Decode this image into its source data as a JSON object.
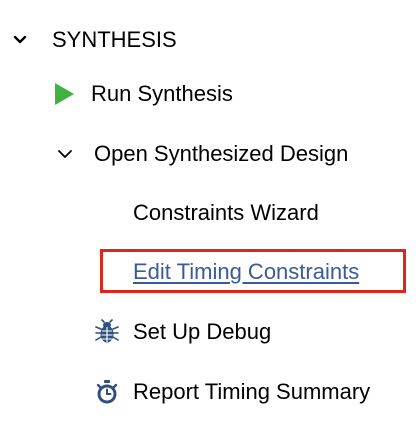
{
  "section": {
    "title": "SYNTHESIS",
    "expanded_icon": "chevron-down-icon"
  },
  "items": {
    "run_synthesis": {
      "label": "Run Synthesis",
      "icon": "play-icon",
      "icon_color": "#3fb23f"
    },
    "open_synthesized": {
      "label": "Open Synthesized Design",
      "icon": "chevron-down-icon"
    },
    "constraints_wizard": {
      "label": "Constraints Wizard"
    },
    "edit_timing": {
      "label": "Edit Timing Constraints",
      "link_color": "#3a5a9c"
    },
    "setup_debug": {
      "label": "Set Up Debug",
      "icon": "bug-icon",
      "icon_color": "#2f4f7f"
    },
    "report_timing": {
      "label": "Report Timing Summary",
      "icon": "stopwatch-icon",
      "icon_color": "#2f4f7f"
    }
  },
  "highlight": {
    "color": "#e0251b"
  }
}
